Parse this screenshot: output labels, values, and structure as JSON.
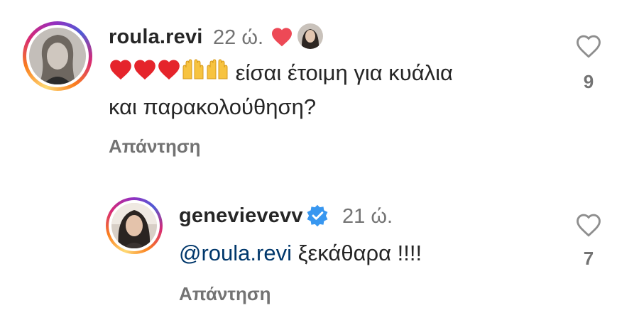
{
  "comments": [
    {
      "username": "roula.revi",
      "time": "22 ώ.",
      "text_line1": " είσαι έτοιμη για κυάλια",
      "text_line2": "και παρακολούθηση?",
      "emojis": [
        "red-heart",
        "red-heart",
        "red-heart",
        "raising-hands",
        "raising-hands"
      ],
      "reply_label": "Απάντηση",
      "like_count": "9",
      "liked_by_author": true
    },
    {
      "username": "genevievevv",
      "verified": true,
      "time": "21 ώ.",
      "mention": "@roula.revi",
      "text": " ξεκάθαρα !!!!",
      "reply_label": "Απάντηση",
      "like_count": "7"
    }
  ],
  "colors": {
    "text": "#262626",
    "secondary": "#737373",
    "mention": "#00376b",
    "heart": "#ed4956",
    "verified": "#3897f0"
  }
}
